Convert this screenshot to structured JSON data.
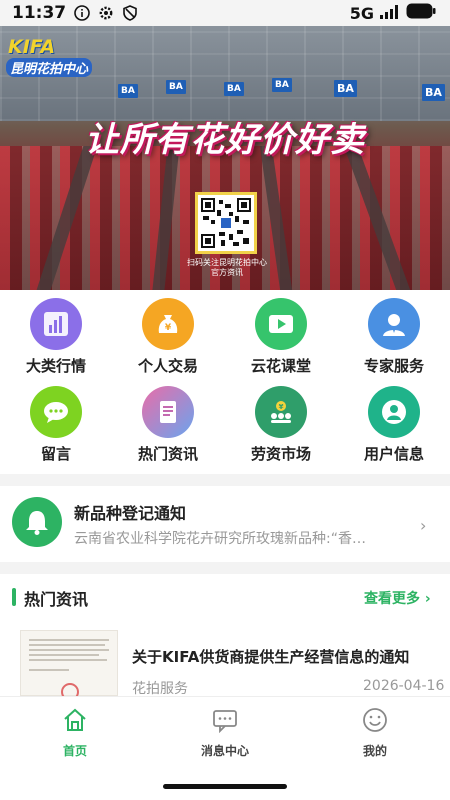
{
  "status_bar": {
    "time": "11:37",
    "network": "5G"
  },
  "banner": {
    "logo_en": "KIFA",
    "logo_cn": "昆明花拍中心",
    "slogan": "让所有花好价好卖",
    "qr_caption_1": "扫码关注昆明花拍中心",
    "qr_caption_2": "官方资讯",
    "sign_text": "BA"
  },
  "menu": [
    {
      "label": "大类行情",
      "icon": "bar-chart-icon",
      "color": "#8b6fe8"
    },
    {
      "label": "个人交易",
      "icon": "money-bag-icon",
      "color": "#f5a623"
    },
    {
      "label": "云花课堂",
      "icon": "video-play-icon",
      "color": "#36c46c"
    },
    {
      "label": "专家服务",
      "icon": "expert-icon",
      "color": "#4a90e2"
    },
    {
      "label": "留言",
      "icon": "chat-bubble-icon",
      "color": "#7ed321"
    },
    {
      "label": "热门资讯",
      "icon": "news-doc-icon",
      "color": "#e96da8"
    },
    {
      "label": "劳资市场",
      "icon": "labor-market-icon",
      "color": "#2f9e6a"
    },
    {
      "label": "用户信息",
      "icon": "user-info-icon",
      "color": "#1fb38a"
    }
  ],
  "notice": {
    "title": "新品种登记通知",
    "desc": "云南省农业科学院花卉研究所玫瑰新品种:“香…"
  },
  "hot_news": {
    "title": "热门资讯",
    "more": "查看更多 ›",
    "items": [
      {
        "title": "关于KIFA供货商提供生产经营信息的通知",
        "source": "花拍服务",
        "date": "2026-04-16"
      }
    ]
  },
  "tabs": [
    {
      "label": "首页",
      "icon": "home-icon",
      "active": true
    },
    {
      "label": "消息中心",
      "icon": "message-icon",
      "active": false
    },
    {
      "label": "我的",
      "icon": "smiley-icon",
      "active": false
    }
  ],
  "colors": {
    "accent": "#2db363",
    "muted": "#999999"
  }
}
